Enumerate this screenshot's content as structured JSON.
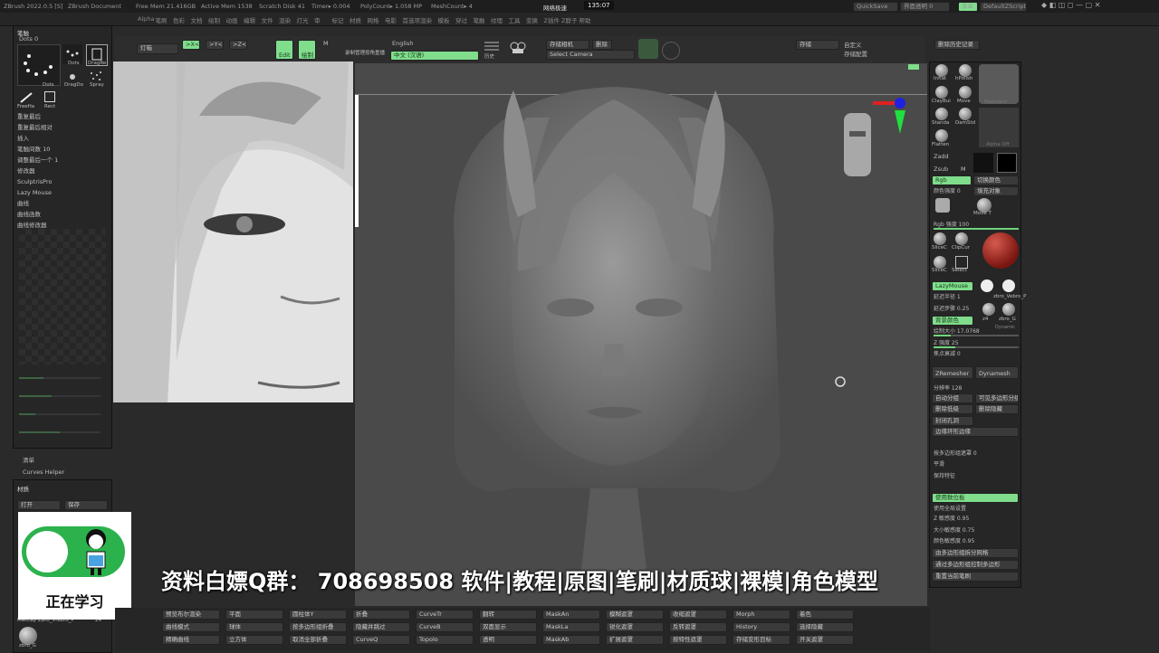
{
  "title_bar": {
    "app": "ZBrush 2022.0.5 [S]",
    "doc": "ZBrush Document",
    "free_mem": "Free Mem 21.416GB",
    "active_mem": "Active Mem 1538",
    "scratch": "Scratch Disk 41",
    "timer": "Timer▸ 0.004",
    "polycount": "PolyCount▸ 1.058 MP",
    "meshcount": "MeshCount▸ 4",
    "net_label": "网络极速",
    "clock": "135:07",
    "quicksave": "QuickSave",
    "ui_transparency": "界面透明 0",
    "menu_btn": "菜单",
    "script": "DefaultZScript"
  },
  "menu_bar": [
    "Alpha",
    "笔刷",
    "色彩",
    "文档",
    "绘制",
    "动画",
    "编辑",
    "文件",
    "渲染",
    "灯光",
    "审",
    "标记",
    "材质",
    "网格",
    "电影",
    "首选项",
    "渲染",
    "模板",
    "穿过",
    "笔触",
    "纹理",
    "工具",
    "变换",
    "Z插件",
    "Z脖子",
    "帮助"
  ],
  "left_panel": {
    "header": "笔触",
    "dots_label": "Dots  0",
    "brushes": [
      "Dots",
      "Dots",
      "DragRe",
      "DragDo",
      "Spray",
      "FreeHa",
      "Rect"
    ],
    "rows": [
      "重复最后",
      "重复最后相对",
      "插入",
      "笔触间数 10",
      "调整最后一个 1",
      "修改器",
      "SculptrisPro",
      "Lazy Mouse",
      "曲线",
      "曲线函数",
      "曲线修改器"
    ],
    "bottom_rows": [
      "清单",
      "Curves Helper"
    ],
    "material_header": "材质",
    "open": "打开",
    "save": "保存",
    "mat_name": "MatCap ZBro_Vrebro_P",
    "mat_num": "24",
    "zbro": "zbro_G"
  },
  "top_toolbar": {
    "light": "灯箱",
    "x": ">X<",
    "y": ">Y<",
    "z": ">Z<",
    "edit": "Edit",
    "draw": "绘制",
    "move": "M",
    "record": "录制管理",
    "replay": "按角重播",
    "english": "English",
    "chinese": "中文 (汉语)",
    "history": "历史",
    "store_camera": "存储相机",
    "delete": "删除",
    "select_camera": "Select Camera",
    "store": "存储",
    "custom_layout": "自定义",
    "delete_history": "删除历史记录",
    "store_config": "存储配置"
  },
  "right_panel": {
    "brushes": [
      "Inflat",
      "hPolish",
      "Standard",
      "ClayBui",
      "Move",
      "Standa",
      "DamStd",
      "Flatten",
      "Alpha Off"
    ],
    "zadd": "Zadd",
    "zsub": "Zsub",
    "m": "M",
    "rgb": "Rgb",
    "switch_color": "切换颜色",
    "rgb_strength_label": "颜色强度 0",
    "fill_object": "填充对象",
    "move_t": "Move T",
    "rgb_strength": "Rgb 强度 100",
    "slice": [
      "SliceC",
      "ClipCur",
      "SliceC",
      "Select"
    ],
    "lazymouse": "LazyMouse",
    "lazy_radius": "延迟半径 1",
    "lazy_step": "延迟步骤 0.25",
    "matcaps": [
      "zbro_Vebro_P",
      "z4",
      "zbro_G",
      "Dynamic"
    ],
    "bg_color": "背景颜色",
    "draw_size": "绘制大小 17.0768",
    "z_intensity": "Z 强度 25",
    "focal": "焦点衰减 0",
    "zremesher": "ZRemesher",
    "dynamesh": "Dynamesh",
    "resolution": "分辨率 128",
    "auto_group": "自动分组",
    "visible_group": "可见多边形分组",
    "delete_lower": "删除低级",
    "delete_hidden": "删除隐藏",
    "close_holes": "封闭孔洞",
    "loop_edge": "边缘环形边缘",
    "poly_group": "按多边形组遮罩 0",
    "smooth": "平滑",
    "feature": "保持特征",
    "use_tablet": "使用数位板",
    "tablet_settings": "使用全局设置",
    "z_sensitivity": "Z 敏感度 0.95",
    "size_sensitivity": "大小敏感度 0.75",
    "color_sensitivity": "颜色敏感度 0.95",
    "group_split": "由多边形组拆分网格",
    "group_mask": "通过多边形组控制多边形",
    "reset_brush": "重置当前笔刷"
  },
  "bottom_bar": {
    "items": [
      "预览布尔渲染",
      "曲线模式",
      "精确曲线",
      "平面",
      "球体",
      "立方体",
      "圆柱体Y",
      "按多边形组折叠",
      "取消全部折叠",
      "折叠",
      "隐藏并跳过",
      "CurveQ",
      "CurveTr",
      "CurveB",
      "Topolo",
      "翻转",
      "双面显示",
      "透明",
      "MaskAn",
      "MaskLa",
      "MaskAb",
      "模糊遮罩",
      "锐化遮罩",
      "扩展遮罩",
      "收缩遮罩",
      "反转遮罩",
      "按特性遮罩",
      "Morph",
      "History",
      "存储变形目标",
      "着色",
      "选择隐藏",
      "开关遮罩"
    ]
  },
  "overlay": {
    "subtitle": "资料白嫖Q群： 708698508 软件|教程|原图|笔刷|材质球|裸模|角色模型",
    "stamp_text": "正在学习"
  },
  "colors": {
    "accent": "#7fdd8c",
    "bg": "#2a2a2a",
    "viewport": "#4a4a4a"
  }
}
